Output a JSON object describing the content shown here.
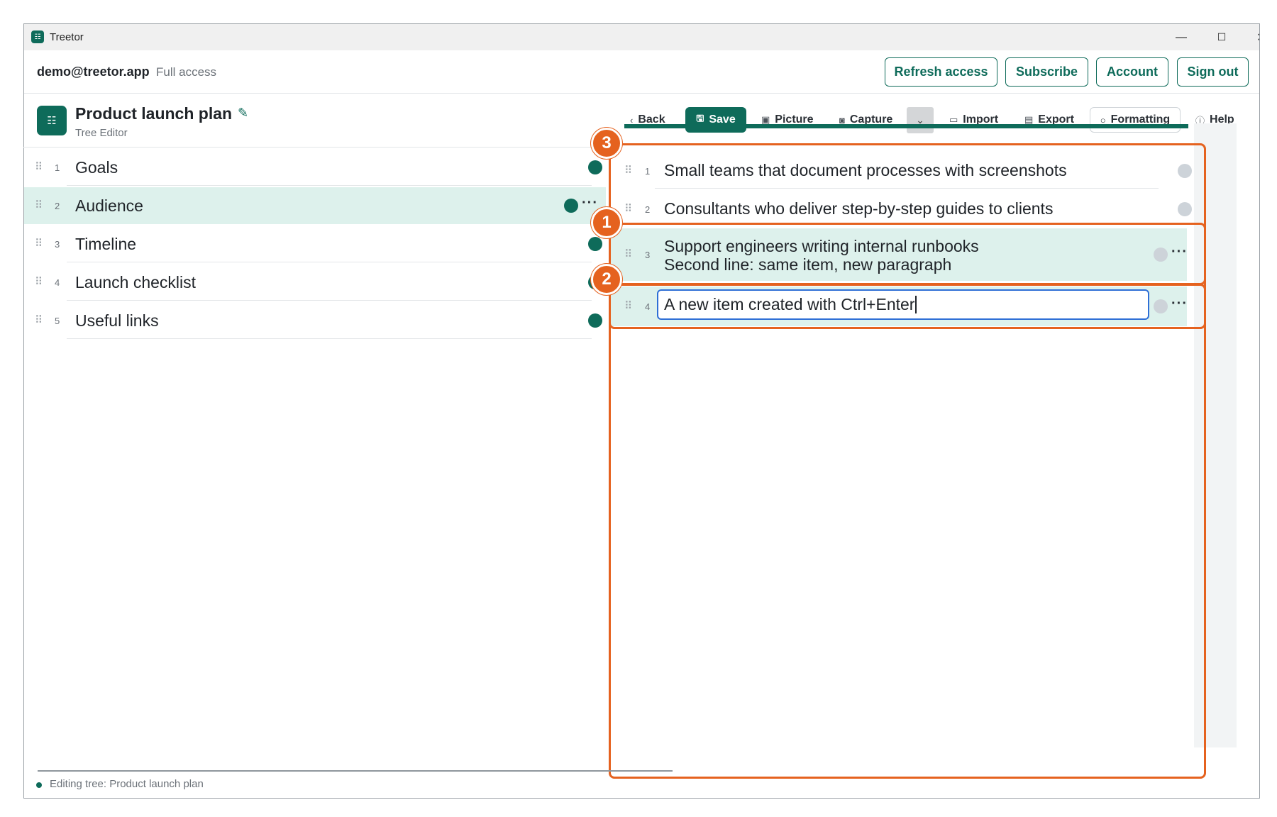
{
  "window": {
    "title": "Treetor",
    "controls": {
      "minimize": "—",
      "maximize": "☐",
      "close": "✕"
    }
  },
  "topbar": {
    "email": "demo@treetor.app",
    "access": "Full access",
    "buttons": {
      "refresh": "Refresh access",
      "subscribe": "Subscribe",
      "account": "Account",
      "signout": "Sign out"
    }
  },
  "document": {
    "title": "Product launch plan",
    "subtitle": "Tree Editor"
  },
  "toolbar": {
    "back": "Back",
    "save": "Save",
    "picture": "Picture",
    "capture": "Capture",
    "import": "Import",
    "export": "Export",
    "formatting": "Formatting",
    "help": "Help"
  },
  "left_items": [
    {
      "num": "1",
      "label": "Goals"
    },
    {
      "num": "2",
      "label": "Audience"
    },
    {
      "num": "3",
      "label": "Timeline"
    },
    {
      "num": "4",
      "label": "Launch checklist"
    },
    {
      "num": "5",
      "label": "Useful links"
    }
  ],
  "right_items": [
    {
      "num": "1",
      "line1": "Small teams that document processes with screenshots"
    },
    {
      "num": "2",
      "line1": "Consultants who deliver step-by-step guides to clients"
    },
    {
      "num": "3",
      "line1": "Support engineers writing internal runbooks",
      "line2": "Second line: same item, new paragraph"
    },
    {
      "num": "4",
      "value": "A new item created with Ctrl+Enter"
    }
  ],
  "annotations": {
    "a1": "1",
    "a2": "2",
    "a3": "3"
  },
  "status": {
    "text": "Editing tree: Product launch plan"
  },
  "colors": {
    "accent": "#0e6b5a",
    "selected_row": "#ddf1ec",
    "annotation": "#e5621f"
  }
}
